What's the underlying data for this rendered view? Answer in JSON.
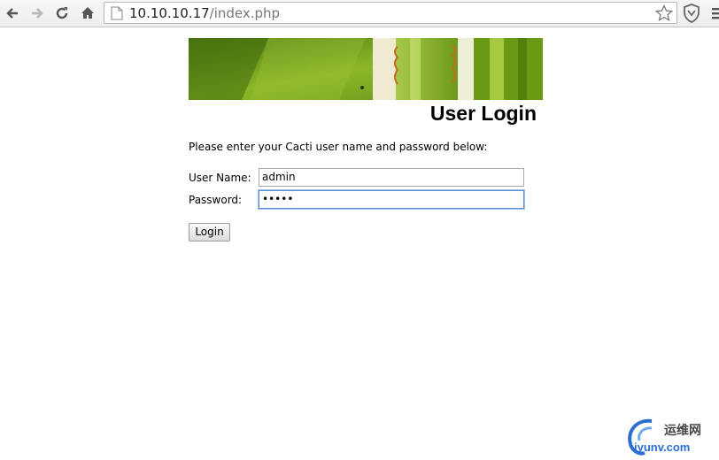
{
  "browser": {
    "url_host": "10.10.10.17",
    "url_path": "/index.php",
    "icons": [
      "back-icon",
      "forward-icon",
      "reload-icon",
      "home-icon",
      "page-icon",
      "star-icon",
      "shield-icon",
      "menu-icon"
    ]
  },
  "page": {
    "title": "User Login",
    "intro": "Please enter your Cacti user name and password below:",
    "username_label": "User Name:",
    "username_value": "admin",
    "password_label": "Password:",
    "password_value": "•••••",
    "login_label": "Login"
  },
  "watermark": {
    "cn": "运维网",
    "en": "iyunv.com"
  },
  "colors": {
    "accent_focus": "#5b8fd6",
    "banner_green": "#6f9a1a",
    "watermark_blue": "#2a6fd0"
  }
}
